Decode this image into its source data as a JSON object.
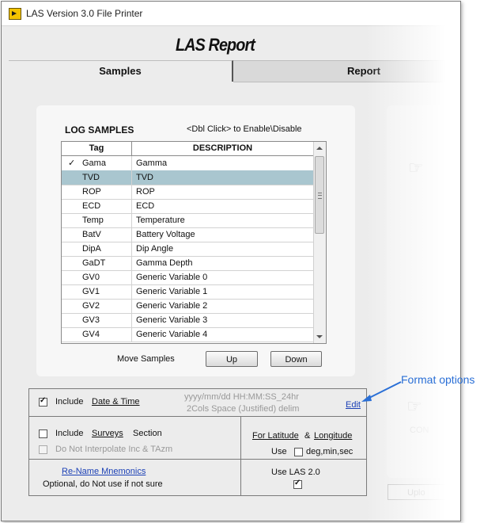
{
  "window": {
    "title": "LAS Version 3.0 File Printer"
  },
  "header": {
    "title": "LAS Report"
  },
  "tabs": [
    {
      "label": "Samples"
    },
    {
      "label": "Report"
    }
  ],
  "log_samples": {
    "title": "LOG SAMPLES",
    "hint": "<Dbl Click> to Enable\\Disable",
    "columns": [
      "Tag",
      "DESCRIPTION"
    ],
    "rows": [
      {
        "check": "✓",
        "tag": "Gama",
        "desc": "Gamma"
      },
      {
        "check": "",
        "tag": "TVD",
        "desc": "TVD"
      },
      {
        "check": "",
        "tag": "ROP",
        "desc": "ROP"
      },
      {
        "check": "",
        "tag": "ECD",
        "desc": "ECD"
      },
      {
        "check": "",
        "tag": "Temp",
        "desc": "Temperature"
      },
      {
        "check": "",
        "tag": "BatV",
        "desc": "Battery Voltage"
      },
      {
        "check": "",
        "tag": "DipA",
        "desc": "Dip Angle"
      },
      {
        "check": "",
        "tag": "GaDT",
        "desc": "Gamma Depth"
      },
      {
        "check": "",
        "tag": "GV0",
        "desc": "Generic Variable 0"
      },
      {
        "check": "",
        "tag": "GV1",
        "desc": "Generic Variable 1"
      },
      {
        "check": "",
        "tag": "GV2",
        "desc": "Generic Variable 2"
      },
      {
        "check": "",
        "tag": "GV3",
        "desc": "Generic Variable 3"
      },
      {
        "check": "",
        "tag": "GV4",
        "desc": "Generic Variable 4"
      }
    ],
    "selected_tag": "TVD",
    "move_label": "Move Samples",
    "up_label": "Up",
    "down_label": "Down"
  },
  "options": {
    "include_label": "Include",
    "date_time_label": "Date & Time",
    "date_time_checked": true,
    "format_line1": "yyyy/mm/dd HH:MM:SS_24hr",
    "format_line2": "2Cols Space (Justified) delim",
    "edit_label": "Edit",
    "surveys_label": "Surveys",
    "section_label": "Section",
    "surveys_checked": false,
    "no_interp_label": "Do Not Interpolate Inc & TAzm",
    "no_interp_checked": false,
    "latitude_label": "For Latitude",
    "amp": "&",
    "longitude_label": "Longitude",
    "use_label": "Use",
    "dms_label": "deg,min,sec",
    "dms_checked": false,
    "rename_label": "Re-Name Mnemonics",
    "optional_note": "Optional, do Not use if not sure",
    "las2_label": "Use LAS 2.0",
    "las2_checked": true
  },
  "annotation": {
    "format_options": "Format options",
    "color": "#2a6fd6"
  },
  "right_panel": {
    "partial_text": "CON",
    "upload_partial": "Uplo"
  }
}
